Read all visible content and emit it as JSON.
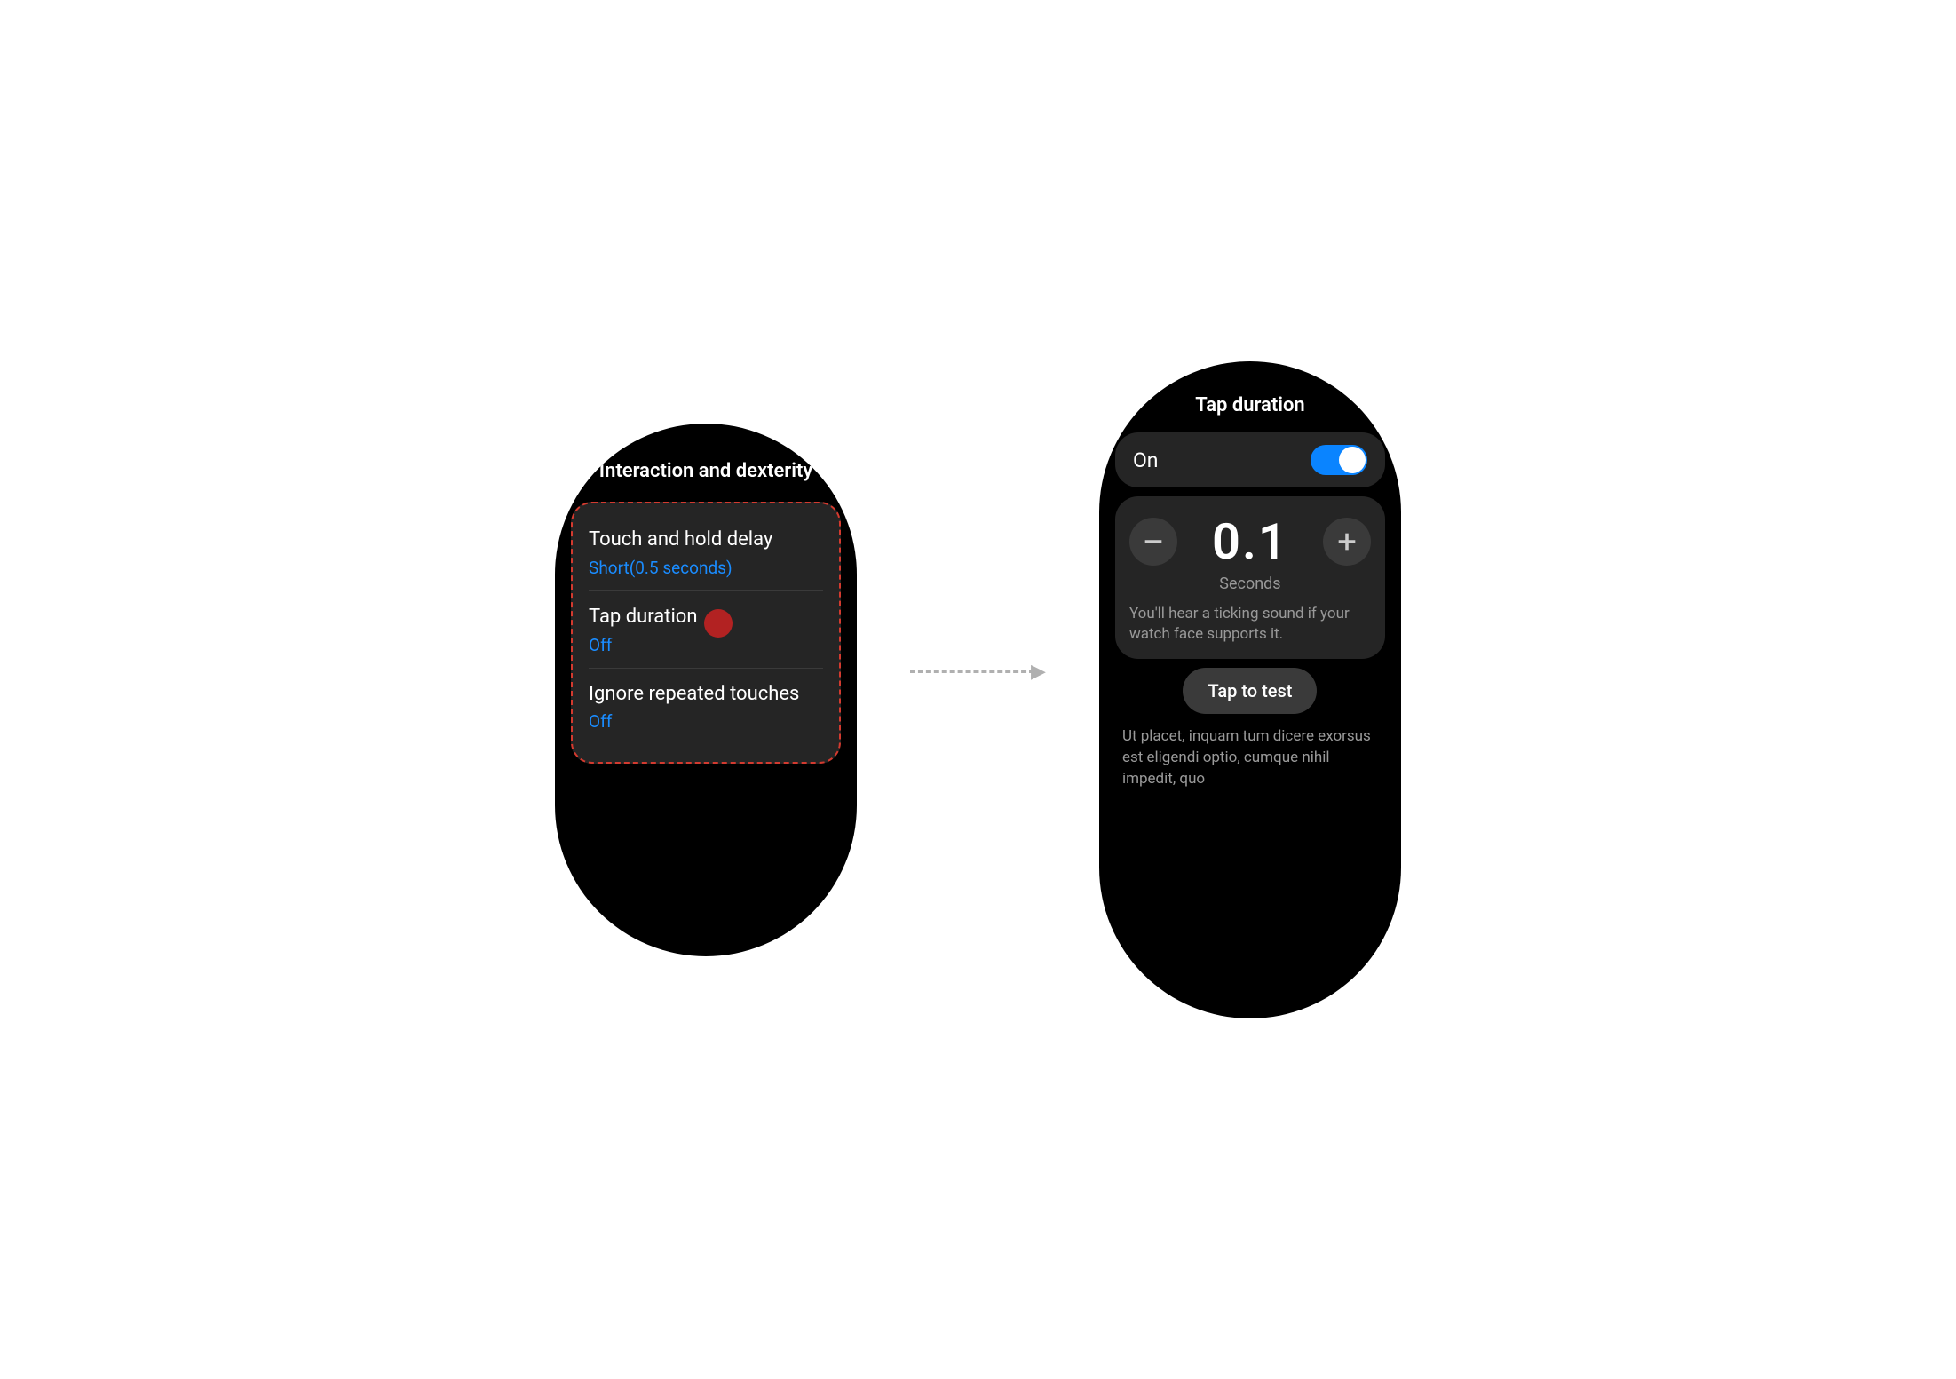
{
  "left": {
    "title": "Interaction and dexterity",
    "items": [
      {
        "title": "Touch and hold delay",
        "sub": "Short(0.5 seconds)"
      },
      {
        "title": "Tap duration",
        "sub": "Off"
      },
      {
        "title": "Ignore repeated touches",
        "sub": "Off"
      }
    ]
  },
  "right": {
    "title": "Tap duration",
    "toggle_label": "On",
    "stepper_value": "0.1",
    "stepper_unit": "Seconds",
    "stepper_desc": "You'll hear a ticking sound if your watch face supports it.",
    "test_button": "Tap to test",
    "bottom_text": "Ut placet, inquam tum dicere exorsus est eligendi optio, cumque nihil impedit, quo"
  }
}
